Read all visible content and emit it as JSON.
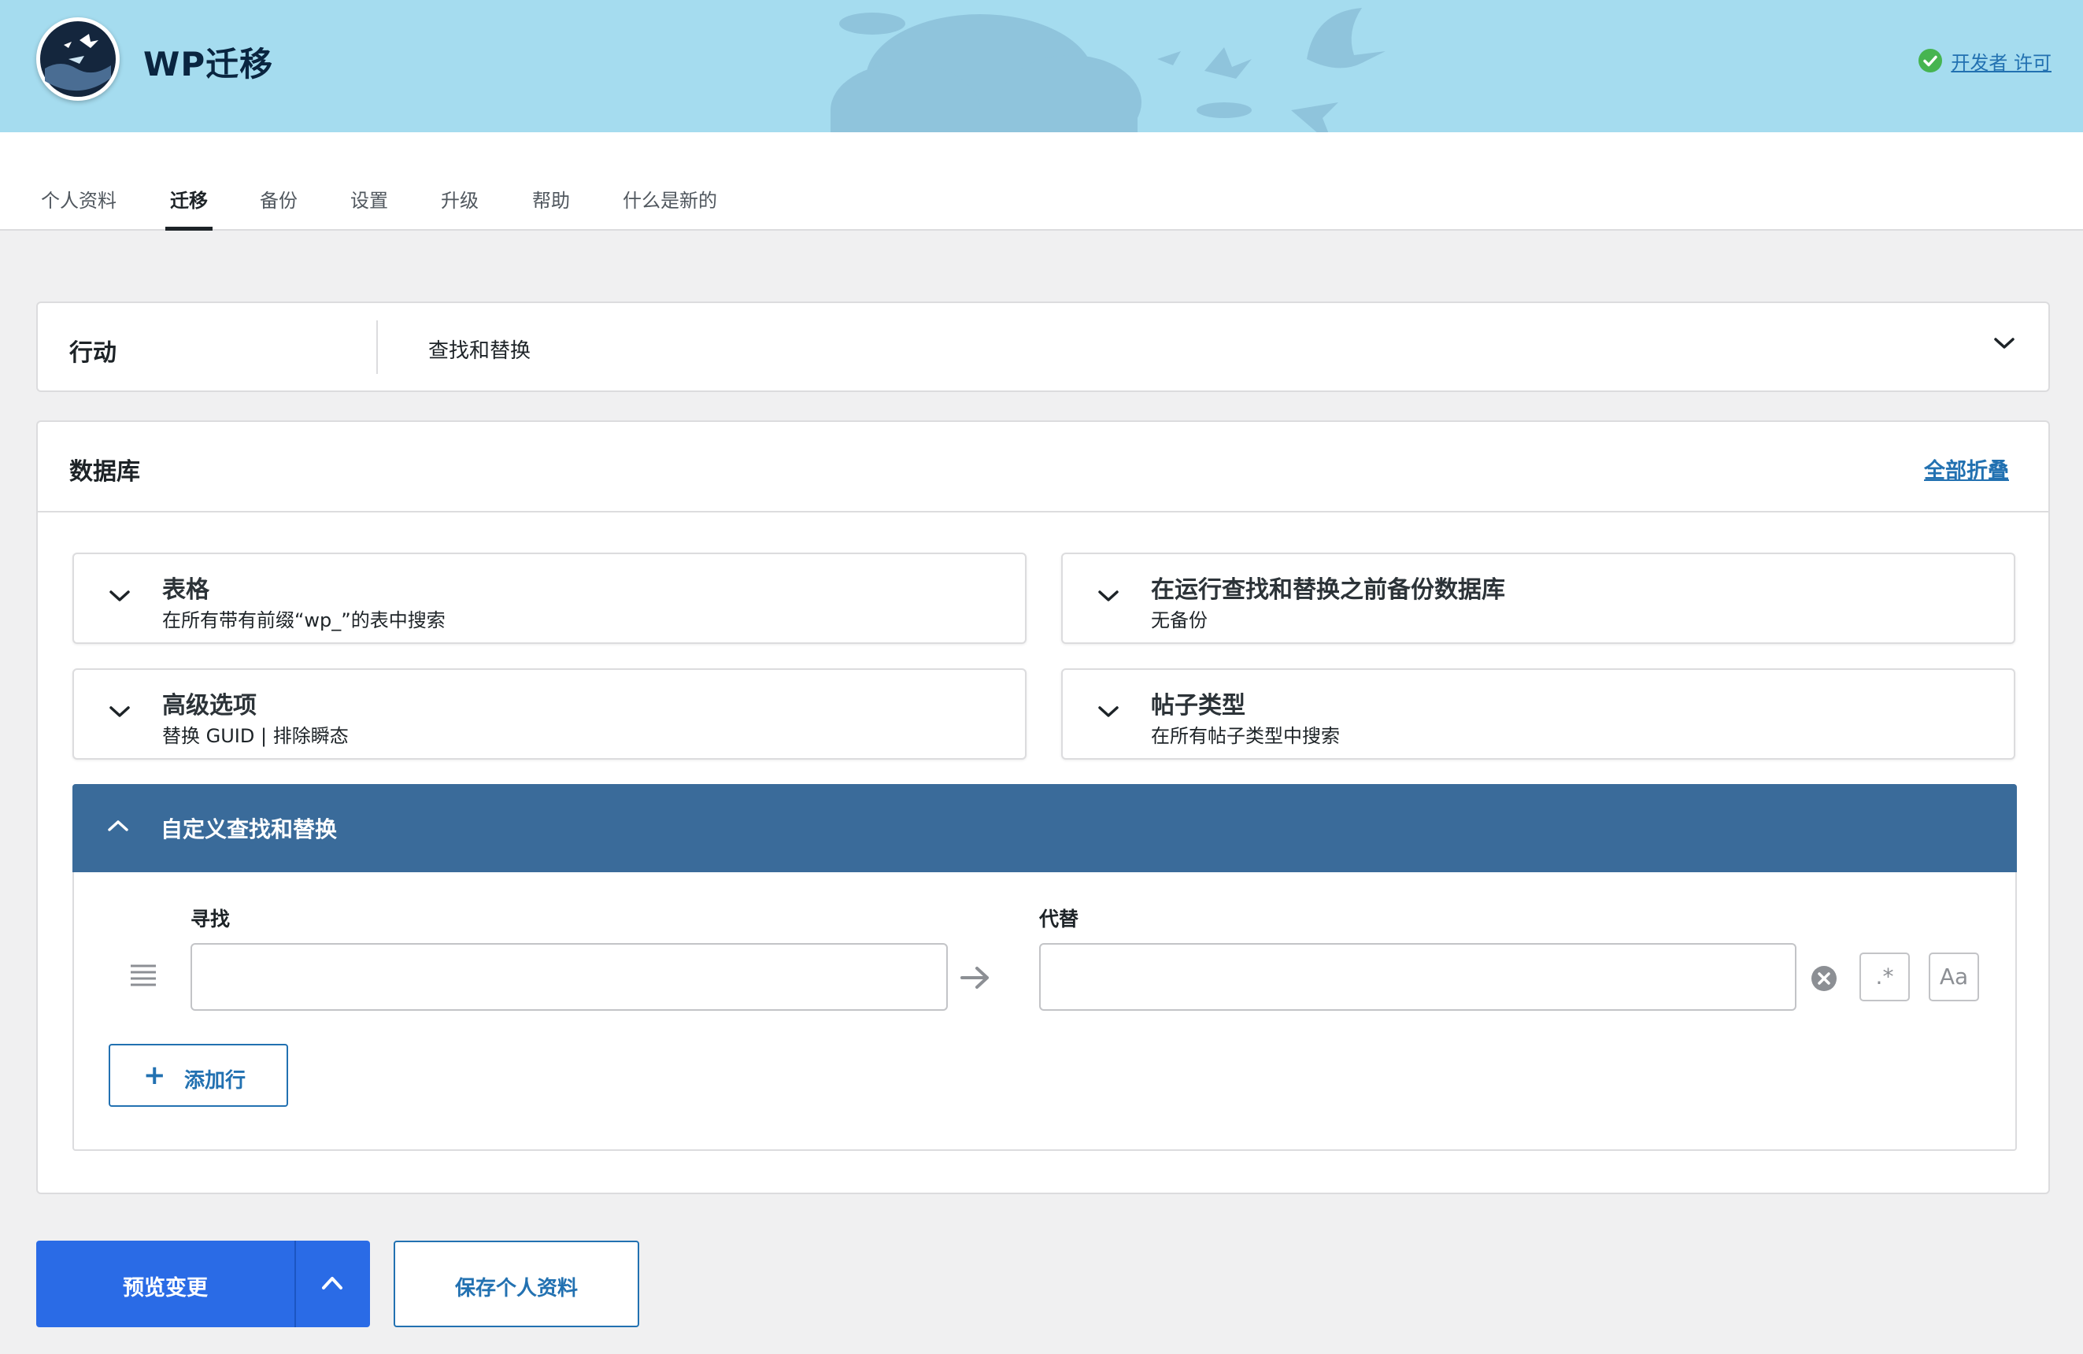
{
  "app": {
    "title": "WP迁移",
    "license_text": "开发者 许可"
  },
  "tabs": [
    {
      "label": "个人资料",
      "active": false
    },
    {
      "label": "迁移",
      "active": true
    },
    {
      "label": "备份",
      "active": false
    },
    {
      "label": "设置",
      "active": false
    },
    {
      "label": "升级",
      "active": false
    },
    {
      "label": "帮助",
      "active": false
    },
    {
      "label": "什么是新的",
      "active": false
    }
  ],
  "action": {
    "label": "行动",
    "value": "查找和替换"
  },
  "database": {
    "title": "数据库",
    "collapse_all": "全部折叠",
    "cards": [
      {
        "title": "表格",
        "subtitle": "在所有带有前缀“wp_”的表中搜索"
      },
      {
        "title": "在运行查找和替换之前备份数据库",
        "subtitle": "无备份"
      },
      {
        "title": "高级选项",
        "subtitle": "替换 GUID | 排除瞬态"
      },
      {
        "title": "帖子类型",
        "subtitle": "在所有帖子类型中搜索"
      }
    ],
    "custom": {
      "title": "自定义查找和替换",
      "find_label": "寻找",
      "replace_label": "代替",
      "find_value": "",
      "replace_value": "",
      "regex_label": ".*",
      "case_label": "Aa",
      "add_row_plus": "+",
      "add_row_label": "添加行"
    }
  },
  "buttons": {
    "preview": "预览变更",
    "save_profile": "保存个人资料"
  },
  "colors": {
    "header_bg": "#a5dcef",
    "primary_blue": "#2a6be6",
    "link_blue": "#2271b1",
    "custom_header_bg": "#3a6b9a",
    "license_check": "#46b450"
  },
  "icons": {
    "logo": "geese-logo-icon",
    "license": "check-circle-icon",
    "chevron_down": "chevron-down-icon",
    "chevron_up": "chevron-up-icon",
    "drag": "drag-handle-icon",
    "arrow": "arrow-right-icon",
    "clear": "clear-circle-icon"
  }
}
